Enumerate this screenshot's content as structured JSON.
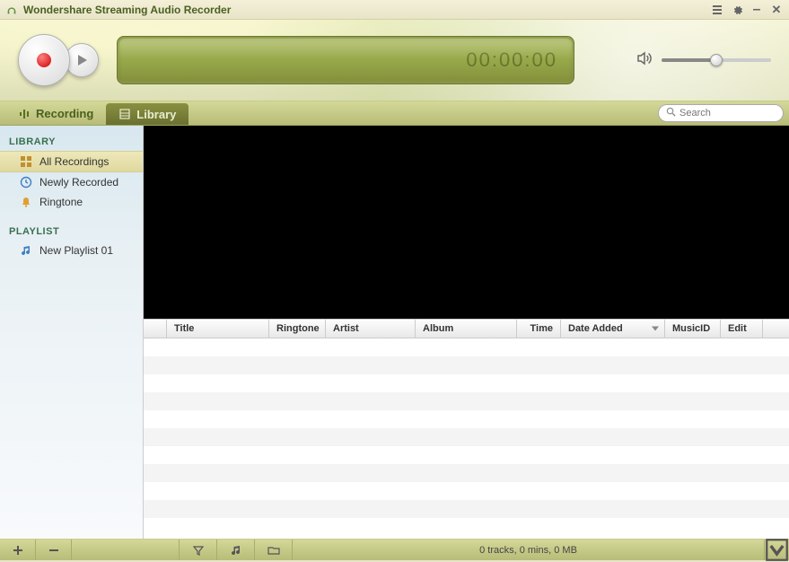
{
  "app": {
    "title": "Wondershare Streaming Audio Recorder"
  },
  "lcd": {
    "time": "00:00:00"
  },
  "tabs": {
    "recording": "Recording",
    "library": "Library"
  },
  "search": {
    "placeholder": "Search"
  },
  "sidebar": {
    "sections": {
      "library": {
        "title": "LIBRARY",
        "items": [
          {
            "label": "All Recordings"
          },
          {
            "label": "Newly Recorded"
          },
          {
            "label": "Ringtone"
          }
        ]
      },
      "playlist": {
        "title": "PLAYLIST",
        "items": [
          {
            "label": "New Playlist 01"
          }
        ]
      }
    }
  },
  "columns": {
    "title": "Title",
    "ringtone": "Ringtone",
    "artist": "Artist",
    "album": "Album",
    "time": "Time",
    "date": "Date Added",
    "musicid": "MusicID",
    "edit": "Edit"
  },
  "status": {
    "text": "0 tracks, 0 mins, 0 MB"
  }
}
